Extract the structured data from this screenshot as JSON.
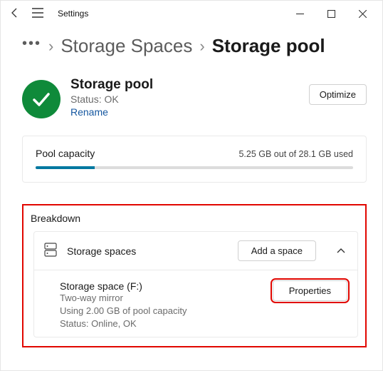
{
  "titlebar": {
    "title": "Settings"
  },
  "breadcrumb": {
    "ellipsis": "•••",
    "prev": "Storage Spaces",
    "current": "Storage pool"
  },
  "pool": {
    "name": "Storage pool",
    "status": "Status: OK",
    "rename": "Rename",
    "optimize": "Optimize"
  },
  "capacity": {
    "label": "Pool capacity",
    "used_text": "5.25 GB out of 28.1 GB used"
  },
  "breakdown": {
    "title": "Breakdown",
    "section_label": "Storage spaces",
    "add_label": "Add a space",
    "space": {
      "name": "Storage space (F:)",
      "type": "Two-way mirror",
      "usage": "Using 2.00 GB of pool capacity",
      "status": "Status: Online, OK",
      "properties": "Properties"
    }
  }
}
